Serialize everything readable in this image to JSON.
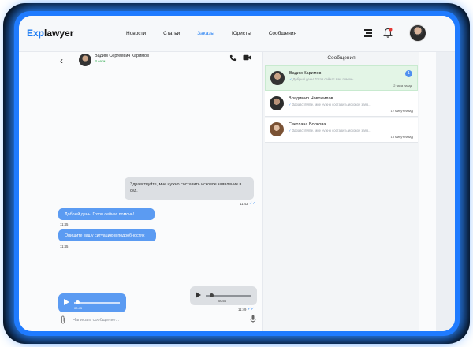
{
  "header": {
    "logo_prefix": "Exp",
    "logo_suffix": "lawyer",
    "nav": [
      "Новости",
      "Статьи",
      "Заказы",
      "Юристы",
      "Сообщения"
    ],
    "active_nav": "Заказы"
  },
  "chat": {
    "contact_name": "Вадим Сергеевич Каримов",
    "contact_status": "В сети",
    "messages": [
      {
        "text": "Здравствуйте, мне нужно составить исковое заявление в суд.",
        "time": "11:43"
      },
      {
        "text": "Добрый день. Готов сейчас помочь!",
        "time": "11:45"
      },
      {
        "text": "Опишите вашу ситуацию в подробностях",
        "time": "11:45"
      },
      {
        "duration": "00:56",
        "time": "11:49"
      },
      {
        "duration": "00:43",
        "time": "11:55"
      }
    ],
    "input_placeholder": "Написать сообщение..."
  },
  "conversations": {
    "title": "Сообщения",
    "items": [
      {
        "name": "Вадим Каримов",
        "preview": "Добрый день! Готов сейчас вам помочь",
        "time": "2 часа назад",
        "unread": "1"
      },
      {
        "name": "Владимир Новожилов",
        "preview": "Здравствуйте, мне нужно составить исковое заяв...",
        "time": "12 минут назад"
      },
      {
        "name": "Светлана Волкова",
        "preview": "Здравствуйте, мне нужно составить исковое заяв...",
        "time": "18 минут назад"
      }
    ]
  },
  "colors": {
    "accent": "#1e7cf2",
    "incoming_bubble": "#5b9bf2",
    "outgoing_bubble": "#dcdfe3",
    "active_conversation": "#e3f5e6",
    "online": "#2ba84a",
    "frame_glow": "#1f7bff"
  },
  "icons": [
    "menu-icon",
    "bell-icon",
    "back-arrow-icon",
    "phone-icon",
    "video-camera-icon",
    "play-icon",
    "paperclip-icon",
    "microphone-icon",
    "double-check-icon"
  ]
}
